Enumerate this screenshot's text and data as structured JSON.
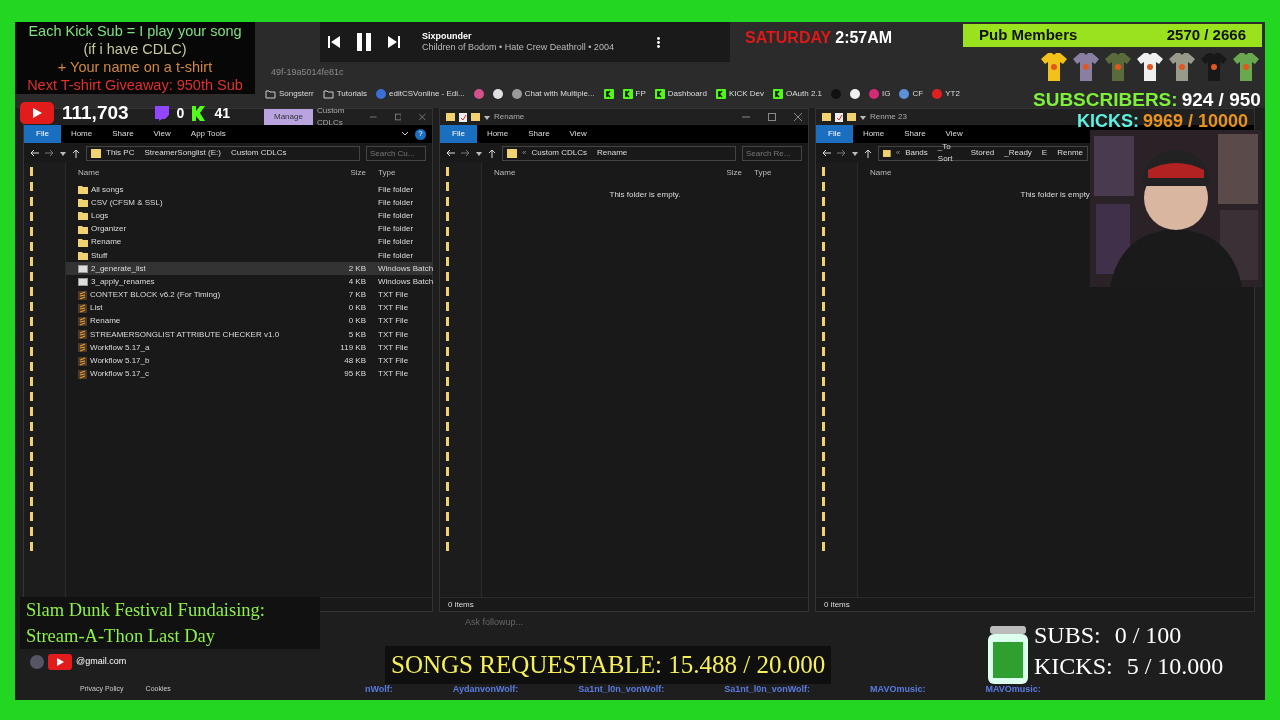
{
  "overlay_message": [
    "Each Kick Sub = I play your song",
    "(if i have CDLC)",
    "+ Your name on a t-shirt",
    "Next T-shirt Giveaway: 950th Sub"
  ],
  "counters": {
    "youtube": "111,703",
    "twitch": "0",
    "kick": "41"
  },
  "media_player": {
    "title": "Sixpounder",
    "subtitle": "Children of Bodom • Hate Crew Deathroll • 2004",
    "playing": true
  },
  "clock": {
    "day": "SATURDAY",
    "time": "2:57AM"
  },
  "pub_members": {
    "label": "Pub Members",
    "value": "2570 / 2666"
  },
  "subscribers": {
    "label": "SUBSCRIBERS:",
    "value": "924 / 950"
  },
  "kicks": {
    "label": "KICKS:",
    "value": "9969 / 10000"
  },
  "browser": {
    "url": "49f-19a5014fe81c",
    "ask_placeholder": "Ask followup...",
    "bookmarks": [
      {
        "kind": "folder",
        "label": "Songsterr"
      },
      {
        "kind": "folder",
        "label": "Tutorials"
      },
      {
        "kind": "site",
        "label": "editCSVonline - Edi...",
        "color": "#3b6fd6"
      },
      {
        "kind": "site",
        "color": "#d4508a"
      },
      {
        "kind": "site",
        "color": "#e0e0e0"
      },
      {
        "kind": "site",
        "label": "Chat with Multiple...",
        "color": "#9a9a9a"
      },
      {
        "kind": "kick"
      },
      {
        "kind": "kick",
        "label": "FP"
      },
      {
        "kind": "kick",
        "label": "Dashboard"
      },
      {
        "kind": "kick",
        "label": "KICK Dev"
      },
      {
        "kind": "kick",
        "label": "OAuth 2.1"
      },
      {
        "kind": "site",
        "color": "#111111"
      },
      {
        "kind": "site",
        "color": "#f0f0f0"
      },
      {
        "kind": "site",
        "label": "IG",
        "color": "#d62976"
      },
      {
        "kind": "site",
        "label": "CF",
        "color": "#5b8fd6"
      },
      {
        "kind": "site",
        "label": "YT2",
        "color": "#e02020"
      }
    ]
  },
  "windows": [
    {
      "title": "Custom CDLCs",
      "context_tab": "Manage",
      "window_controls": true,
      "help_label": "?",
      "ribbon_tabs": [
        {
          "kind": "file_menu",
          "label": "File"
        },
        {
          "kind": "tab",
          "label": "Home"
        },
        {
          "kind": "tab",
          "label": "Share"
        },
        {
          "kind": "tab",
          "label": "View"
        },
        {
          "kind": "tab",
          "label": "App Tools"
        }
      ],
      "path": [
        "This PC",
        "StreamerSonglist (E:)",
        "Custom CDLCs"
      ],
      "search_placeholder": "Search Cu...",
      "columns": [
        "Name",
        "Size",
        "Type"
      ],
      "rows": [
        {
          "kind": "folder",
          "name": "All songs",
          "type": "File folder",
          "selected": false
        },
        {
          "kind": "folder",
          "name": "CSV (CFSM & SSL)",
          "type": "File folder",
          "selected": false
        },
        {
          "kind": "folder",
          "name": "Logs",
          "type": "File folder",
          "selected": false
        },
        {
          "kind": "folder",
          "name": "Organizer",
          "type": "File folder",
          "selected": false
        },
        {
          "kind": "folder",
          "name": "Rename",
          "type": "File folder",
          "selected": false
        },
        {
          "kind": "folder",
          "name": "Stuff",
          "type": "File folder",
          "selected": false
        },
        {
          "kind": "batch",
          "name": "2_generate_list",
          "size": "2 KB",
          "type": "Windows Batch",
          "selected": true
        },
        {
          "kind": "batch",
          "name": "3_apply_renames",
          "size": "4 KB",
          "type": "Windows Batch",
          "selected": false
        },
        {
          "kind": "text",
          "name": "CONTEXT BLOCK v6.2 (For Timing)",
          "size": "7 KB",
          "type": "TXT File",
          "selected": false
        },
        {
          "kind": "text",
          "name": "List",
          "size": "0 KB",
          "type": "TXT File",
          "selected": false
        },
        {
          "kind": "text",
          "name": "Rename",
          "size": "0 KB",
          "type": "TXT File",
          "selected": false
        },
        {
          "kind": "text",
          "name": "STREAMERSONGLIST ATTRIBUTE CHECKER v1.0",
          "size": "5 KB",
          "type": "TXT File",
          "selected": false
        },
        {
          "kind": "text",
          "name": "Workflow 5.17_a",
          "size": "119 KB",
          "type": "TXT File",
          "selected": false
        },
        {
          "kind": "text",
          "name": "Workflow 5.17_b",
          "size": "48 KB",
          "type": "TXT File",
          "selected": false
        },
        {
          "kind": "text",
          "name": "Workflow 5.17_c",
          "size": "95 KB",
          "type": "TXT File",
          "selected": false
        }
      ]
    },
    {
      "title": "Rename",
      "window_controls": true,
      "ribbon_tabs": [
        {
          "kind": "file_menu",
          "label": "File"
        },
        {
          "kind": "tab",
          "label": "Home"
        },
        {
          "kind": "tab",
          "label": "Share"
        },
        {
          "kind": "tab",
          "label": "View"
        }
      ],
      "path_overflow": "«",
      "path": [
        "Custom CDLCs",
        "Rename"
      ],
      "search_placeholder": "Search Re...",
      "columns": [
        "Name",
        "Size",
        "Type"
      ],
      "empty_message": "This folder is empty.",
      "status": "0 items"
    },
    {
      "title": "Renme 23",
      "window_controls": false,
      "ribbon_tabs": [
        {
          "kind": "file_menu",
          "label": "File"
        },
        {
          "kind": "tab",
          "label": "Home"
        },
        {
          "kind": "tab",
          "label": "Share"
        },
        {
          "kind": "tab",
          "label": "View"
        }
      ],
      "path_overflow": "«",
      "path": [
        "Bands",
        "_To Sort",
        "Stored",
        "_Ready",
        "E",
        "Renme"
      ],
      "columns": [
        "Name"
      ],
      "empty_message": "This folder is empty.",
      "status": "0 items"
    }
  ],
  "fundraiser": {
    "lines": [
      "Slam Dunk Festival Fundaising:",
      "Stream-A-Thon Last Day"
    ]
  },
  "channel_email": "@gmail.com",
  "footer_links": [
    "Privacy Policy",
    "Cookies"
  ],
  "songs_requestable": "SONGS REQUESTABLE: 15.488 / 20.000",
  "goals": [
    {
      "label": "SUBS:",
      "value": "0 / 100"
    },
    {
      "label": "KICKS:",
      "value": "5 / 10.000"
    }
  ],
  "chat_ticker": [
    "nWolf:",
    "AydanvonWolf:",
    "Sa1nt_l0n_vonWolf:",
    "Sa1nt_l0n_vonWolf:",
    "MAVOmusic:",
    "MAVOmusic:"
  ]
}
